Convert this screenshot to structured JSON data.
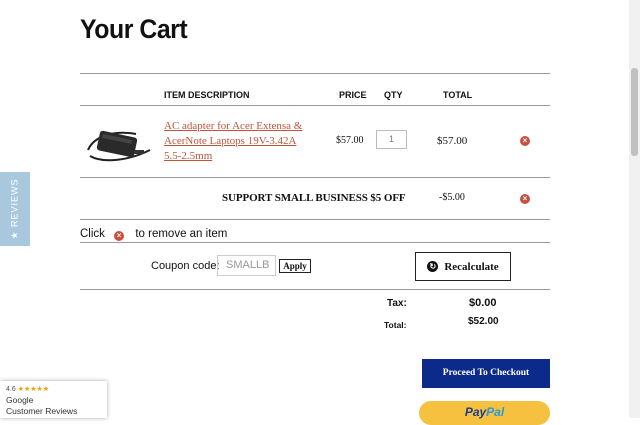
{
  "page": {
    "title": "Your Cart"
  },
  "table": {
    "headers": {
      "item": "ITEM DESCRIPTION",
      "price": "PRICE",
      "qty": "QTY",
      "total": "TOTAL"
    }
  },
  "item": {
    "name": "AC adapter for Acer Extensa & AcerNote Laptops 19V-3.42A 5.5-2.5mm",
    "price": "$57.00",
    "qty": "1",
    "total": "$57.00"
  },
  "discount": {
    "label": "SUPPORT SMALL BUSINESS $5 OFF",
    "value": "-$5.00"
  },
  "remove_hint": {
    "before": "Click",
    "after": "to remove an item"
  },
  "coupon": {
    "label": "Coupon code:",
    "value": "SMALLB",
    "apply_label": "Apply"
  },
  "recalculate_label": "Recalculate",
  "summary": {
    "tax_label": "Tax:",
    "tax_value": "$0.00",
    "total_label": "Total:",
    "total_value": "$52.00"
  },
  "checkout_label": "Proceed To Checkout",
  "paypal": {
    "part1": "Pay",
    "part2": "Pal"
  },
  "reviews_tab_label": "★ REVIEWS",
  "google_badge": {
    "rating": "4.6",
    "stars": "★★★★★",
    "line1": "Google",
    "line2": "Customer Reviews"
  },
  "colors": {
    "checkout": "#0c2a8a",
    "paypal": "#f5c13e",
    "link": "#c0543a",
    "remove": "#c9503d",
    "reviews_tab": "#a9c8de"
  },
  "icons": {
    "remove": "close-circle-icon",
    "recalculate": "refresh-icon"
  }
}
